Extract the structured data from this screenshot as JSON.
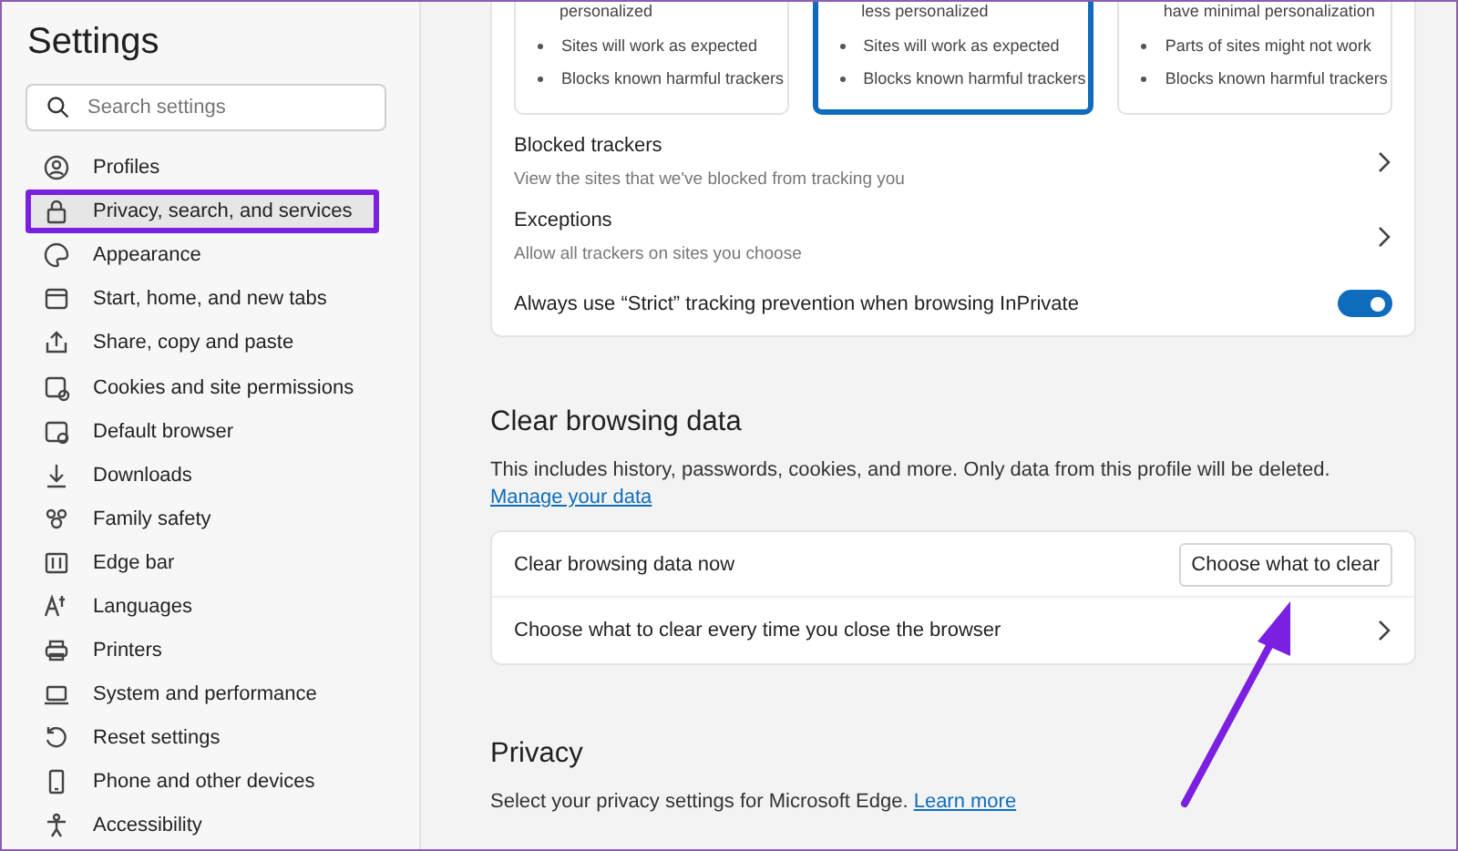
{
  "sidebar": {
    "title": "Settings",
    "search": {
      "placeholder": "Search settings"
    },
    "items": [
      {
        "label": "Profiles",
        "selected": false,
        "highlighted": false
      },
      {
        "label": "Privacy, search, and services",
        "selected": true,
        "highlighted": true
      },
      {
        "label": "Appearance",
        "selected": false,
        "highlighted": false
      },
      {
        "label": "Start, home, and new tabs",
        "selected": false,
        "highlighted": false
      },
      {
        "label": "Share, copy and paste",
        "selected": false,
        "highlighted": false
      },
      {
        "label": "Cookies and site permissions",
        "selected": false,
        "highlighted": false
      },
      {
        "label": "Default browser",
        "selected": false,
        "highlighted": false
      },
      {
        "label": "Downloads",
        "selected": false,
        "highlighted": false
      },
      {
        "label": "Family safety",
        "selected": false,
        "highlighted": false
      },
      {
        "label": "Edge bar",
        "selected": false,
        "highlighted": false
      },
      {
        "label": "Languages",
        "selected": false,
        "highlighted": false
      },
      {
        "label": "Printers",
        "selected": false,
        "highlighted": false
      },
      {
        "label": "System and performance",
        "selected": false,
        "highlighted": false
      },
      {
        "label": "Reset settings",
        "selected": false,
        "highlighted": false
      },
      {
        "label": "Phone and other devices",
        "selected": false,
        "highlighted": false
      },
      {
        "label": "Accessibility",
        "selected": false,
        "highlighted": false
      }
    ]
  },
  "tracking": {
    "cards": [
      {
        "cut_line": "personalized",
        "bullets": [
          "Sites will work as expected",
          "Blocks known harmful trackers"
        ],
        "selected": false
      },
      {
        "cut_line": "less personalized",
        "bullets": [
          "Sites will work as expected",
          "Blocks known harmful trackers"
        ],
        "selected": true
      },
      {
        "cut_line": "have minimal personalization",
        "bullets": [
          "Parts of sites might not work",
          "Blocks known harmful trackers"
        ],
        "selected": false
      }
    ],
    "rows": [
      {
        "title": "Blocked trackers",
        "subtitle": "View the sites that we've blocked from tracking you"
      },
      {
        "title": "Exceptions",
        "subtitle": "Allow all trackers on sites you choose"
      }
    ],
    "toggle": {
      "label": "Always use “Strict” tracking prevention when browsing InPrivate",
      "on": true
    }
  },
  "clear_data": {
    "heading": "Clear browsing data",
    "description": "This includes history, passwords, cookies, and more. Only data from this profile will be deleted.",
    "link": "Manage your data",
    "now_row": {
      "label": "Clear browsing data now",
      "button": "Choose what to clear",
      "pointed_at": true
    },
    "close_row": {
      "label": "Choose what to clear every time you close the browser"
    }
  },
  "privacy": {
    "heading": "Privacy",
    "description": "Select your privacy settings for Microsoft Edge.",
    "link": "Learn more"
  }
}
